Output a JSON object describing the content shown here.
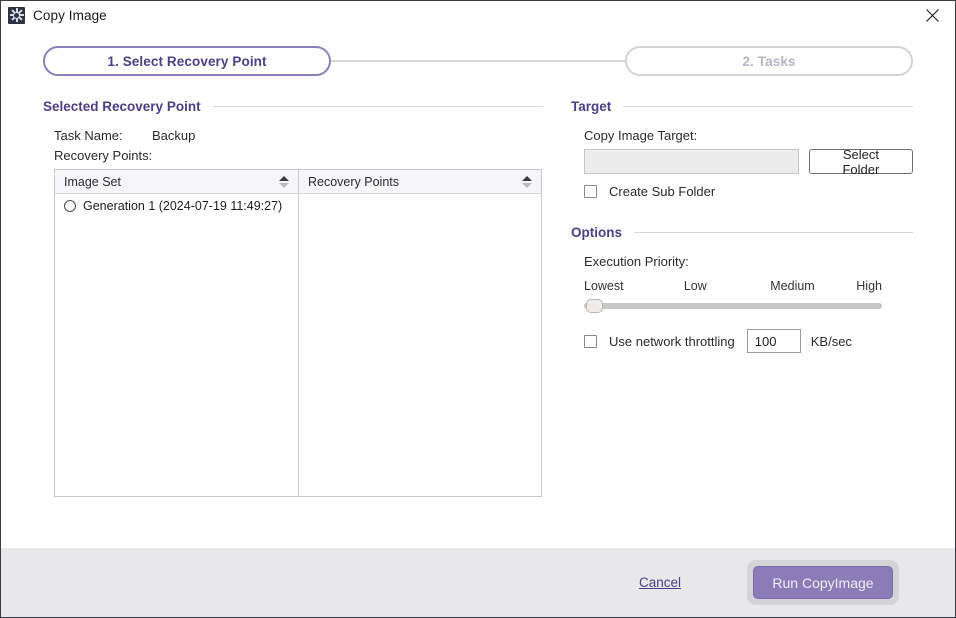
{
  "window": {
    "title": "Copy Image",
    "icon": "app-snowflake-icon",
    "close_icon": "close-icon"
  },
  "stepper": {
    "steps": [
      {
        "label": "1. Select Recovery Point",
        "state": "active"
      },
      {
        "label": "2. Tasks",
        "state": "inactive"
      }
    ]
  },
  "left": {
    "section_title": "Selected Recovery Point",
    "task_name_label": "Task Name:",
    "task_name_value": "Backup",
    "recovery_points_label": "Recovery Points:",
    "table": {
      "columns": [
        {
          "header": "Image Set",
          "sort": "ascending"
        },
        {
          "header": "Recovery Points",
          "sort": "ascending"
        }
      ],
      "rows": [
        {
          "image_set": "Generation 1 (2024-07-19 11:49:27)",
          "selected": false
        }
      ],
      "recovery_points_rows": []
    }
  },
  "right": {
    "target": {
      "section_title": "Target",
      "copy_image_target_label": "Copy Image Target:",
      "copy_image_target_value": "",
      "copy_image_target_placeholder": "",
      "select_folder_button": "Select Folder",
      "create_sub_folder_label": "Create Sub Folder",
      "create_sub_folder_checked": false
    },
    "options": {
      "section_title": "Options",
      "execution_priority_label": "Execution Priority:",
      "priority_ticks": [
        "Lowest",
        "Low",
        "Medium",
        "High"
      ],
      "priority_value": "Lowest",
      "throttle_label": "Use network throttling",
      "throttle_checked": false,
      "throttle_value": "100",
      "throttle_unit": "KB/sec"
    }
  },
  "footer": {
    "cancel_label": "Cancel",
    "run_label": "Run CopyImage"
  },
  "colors": {
    "accent_purple": "#4b3f87",
    "step_border": "#8b81b8",
    "primary_button": "#8b7cb8",
    "footer_bg": "#e8e8ea",
    "table_header_bg": "#f6f6fa"
  }
}
